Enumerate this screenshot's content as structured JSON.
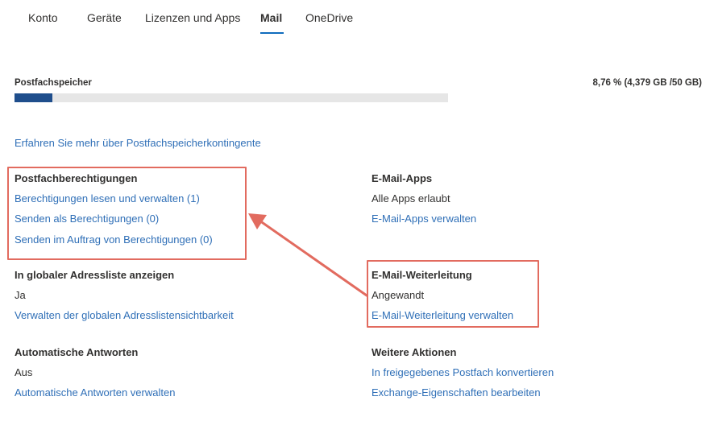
{
  "tabs": [
    {
      "label": "Konto"
    },
    {
      "label": "Geräte"
    },
    {
      "label": "Lizenzen und Apps"
    },
    {
      "label": "Mail"
    },
    {
      "label": "OneDrive"
    }
  ],
  "active_tab": "Mail",
  "storage": {
    "label": "Postfachspeicher",
    "value_text": "8,76 % (4,379 GB /50 GB)",
    "percent_used": 8.76,
    "learn_more": "Erfahren Sie mehr über Postfachspeicherkontingente"
  },
  "sections": {
    "permissions": {
      "heading": "Postfachberechtigungen",
      "links": [
        "Berechtigungen lesen und verwalten (1)",
        "Senden als Berechtigungen (0)",
        "Senden im Auftrag von Berechtigungen (0)"
      ]
    },
    "mail_apps": {
      "heading": "E-Mail-Apps",
      "status": "Alle Apps erlaubt",
      "link": "E-Mail-Apps verwalten"
    },
    "gal": {
      "heading": "In globaler Adressliste anzeigen",
      "status": "Ja",
      "link": "Verwalten der globalen Adresslistensichtbarkeit"
    },
    "forwarding": {
      "heading": "E-Mail-Weiterleitung",
      "status": "Angewandt",
      "link": "E-Mail-Weiterleitung verwalten"
    },
    "auto_replies": {
      "heading": "Automatische Antworten",
      "status": "Aus",
      "link": "Automatische Antworten verwalten"
    },
    "more_actions": {
      "heading": "Weitere Aktionen",
      "links": [
        "In freigegebenes Postfach konvertieren",
        "Exchange-Eigenschaften bearbeiten"
      ]
    }
  },
  "colors": {
    "link": "#2f6fb7",
    "accent": "#0f6cbd",
    "highlight": "#e26b5f",
    "storage_fill": "#1f4e8c"
  }
}
